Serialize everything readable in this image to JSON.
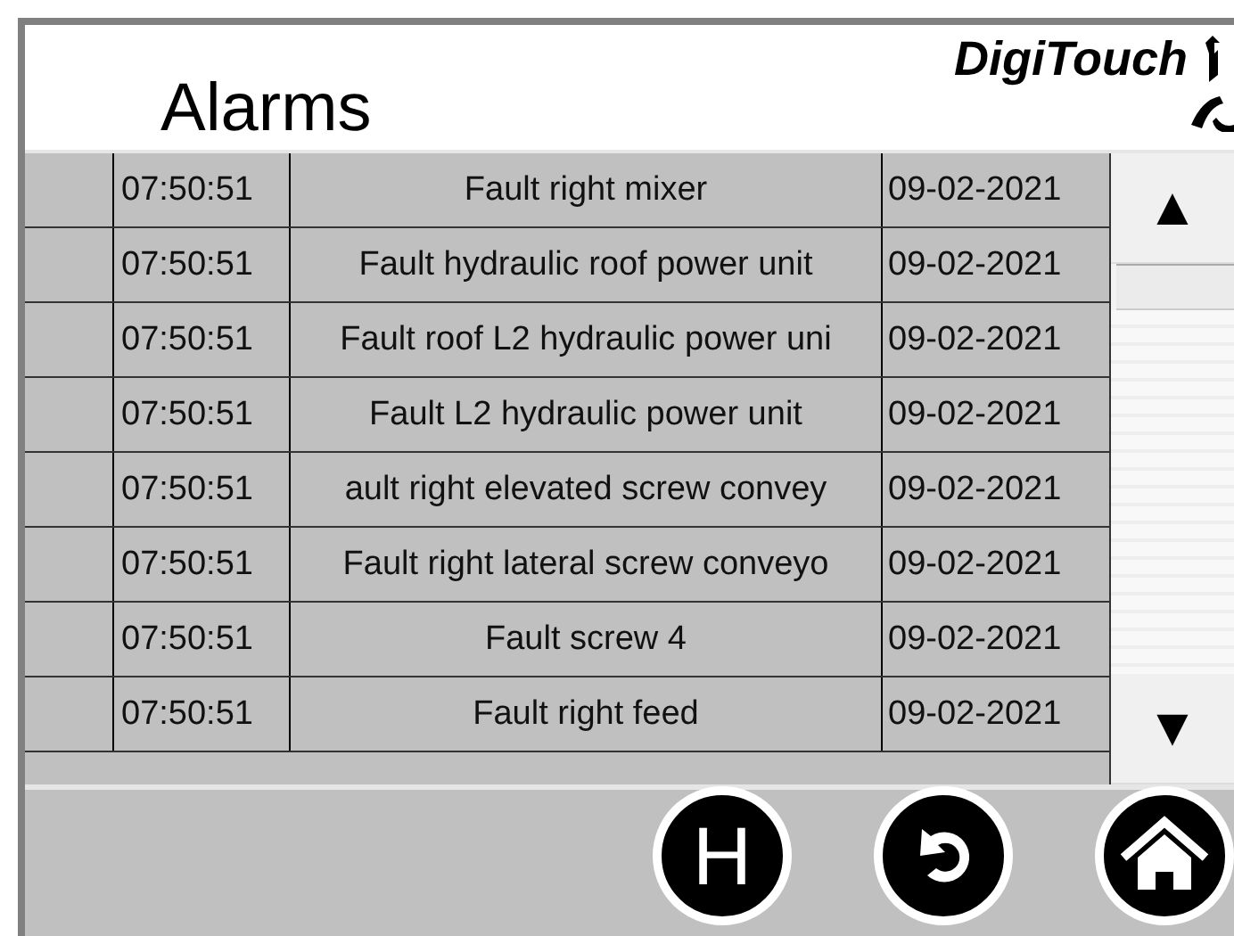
{
  "header": {
    "title": "Alarms",
    "logo": "DigiTouch"
  },
  "alarms": [
    {
      "time": "07:50:51",
      "text": "Fault right mixer",
      "date": "09-02-2021"
    },
    {
      "time": "07:50:51",
      "text": "Fault hydraulic roof power unit",
      "date": "09-02-2021"
    },
    {
      "time": "07:50:51",
      "text": "Fault roof L2 hydraulic power uni",
      "date": "09-02-2021"
    },
    {
      "time": "07:50:51",
      "text": "Fault L2 hydraulic power unit",
      "date": "09-02-2021"
    },
    {
      "time": "07:50:51",
      "text": "ault right elevated screw convey",
      "date": "09-02-2021"
    },
    {
      "time": "07:50:51",
      "text": "Fault right lateral screw conveyo",
      "date": "09-02-2021"
    },
    {
      "time": "07:50:51",
      "text": "Fault screw 4",
      "date": "09-02-2021"
    },
    {
      "time": "07:50:51",
      "text": "Fault right feed",
      "date": "09-02-2021"
    }
  ],
  "scrollbar": {
    "up": "▲",
    "down": "▼"
  },
  "footer": {
    "buttons": [
      {
        "kind": "text",
        "label": "H"
      },
      {
        "kind": "back"
      },
      {
        "kind": "home"
      }
    ]
  }
}
